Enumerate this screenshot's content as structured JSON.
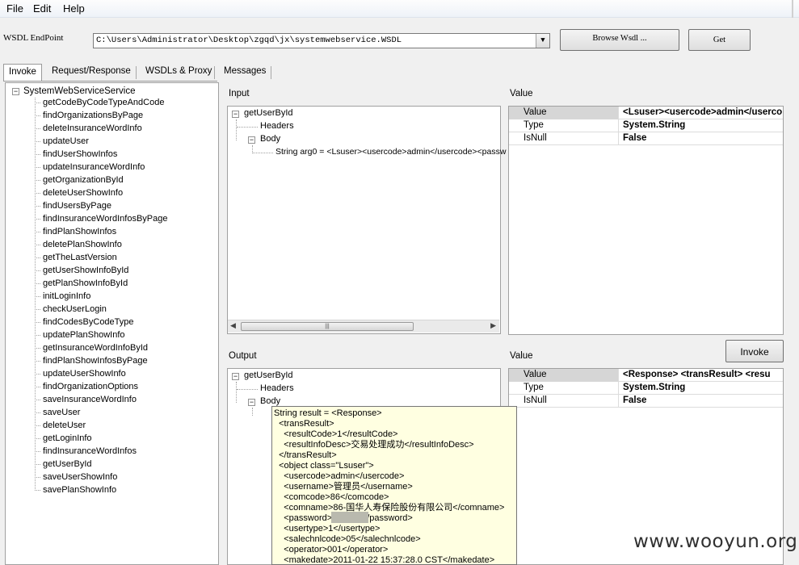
{
  "menu": {
    "file": "File",
    "edit": "Edit",
    "help": "Help"
  },
  "endpoint": {
    "label": "WSDL EndPoint",
    "value": "C:\\Users\\Administrator\\Desktop\\zgqd\\jx\\systemwebservice.WSDL",
    "browse_label": "Browse Wsdl ...",
    "get_label": "Get"
  },
  "tabs": [
    "Invoke",
    "Request/Response",
    "WSDLs & Proxy",
    "Messages"
  ],
  "tree": {
    "root": "SystemWebServiceService",
    "methods": [
      "getCodeByCodeTypeAndCode",
      "findOrganizationsByPage",
      "deleteInsuranceWordInfo",
      "updateUser",
      "findUserShowInfos",
      "updateInsuranceWordInfo",
      "getOrganizationById",
      "deleteUserShowInfo",
      "findUsersByPage",
      "findInsuranceWordInfosByPage",
      "findPlanShowInfos",
      "deletePlanShowInfo",
      "getTheLastVersion",
      "getUserShowInfoById",
      "getPlanShowInfoById",
      "initLoginInfo",
      "checkUserLogin",
      "findCodesByCodeType",
      "updatePlanShowInfo",
      "getInsuranceWordInfoById",
      "findPlanShowInfosByPage",
      "updateUserShowInfo",
      "findOrganizationOptions",
      "saveInsuranceWordInfo",
      "saveUser",
      "deleteUser",
      "getLoginInfo",
      "findInsuranceWordInfos",
      "getUserById",
      "saveUserShowInfo",
      "savePlanShowInfo"
    ]
  },
  "input": {
    "label": "Input",
    "method": "getUserById",
    "headers": "Headers",
    "body": "Body",
    "arg": "String arg0 = <Lsuser><usercode>admin</usercode><passw"
  },
  "input_value": {
    "label": "Value",
    "rows": [
      {
        "key": "Value",
        "val": "<Lsuser><usercode>admin</userco"
      },
      {
        "key": "Type",
        "val": "System.String"
      },
      {
        "key": "IsNull",
        "val": "False"
      }
    ]
  },
  "output": {
    "label": "Output",
    "method": "getUserById",
    "headers": "Headers",
    "body": "Body"
  },
  "output_value": {
    "label": "Value",
    "rows": [
      {
        "key": "Value",
        "val": "<Response>  <transResult>    <resu"
      },
      {
        "key": "Type",
        "val": "System.String"
      },
      {
        "key": "IsNull",
        "val": "False"
      }
    ]
  },
  "invoke_label": "Invoke",
  "tooltip_lines": [
    "String result = <Response>",
    "  <transResult>",
    "    <resultCode>1</resultCode>",
    "    <resultInfoDesc>交易处理成功</resultInfoDesc>",
    "  </transResult>",
    "  <object class=\"Lsuser\">",
    "    <usercode>admin</usercode>",
    "    <username>管理员</username>",
    "    <comcode>86</comcode>",
    "    <comname>86-国华人寿保险股份有限公司</comname>",
    "    <password>g          </password>",
    "    <usertype>1</usertype>",
    "    <salechnlcode>05</salechnlcode>",
    "    <operator>001</operator>",
    "    <makedate>2011-01-22 15:37:28.0 CST</makedate>"
  ],
  "watermark": "www.wooyun.org"
}
